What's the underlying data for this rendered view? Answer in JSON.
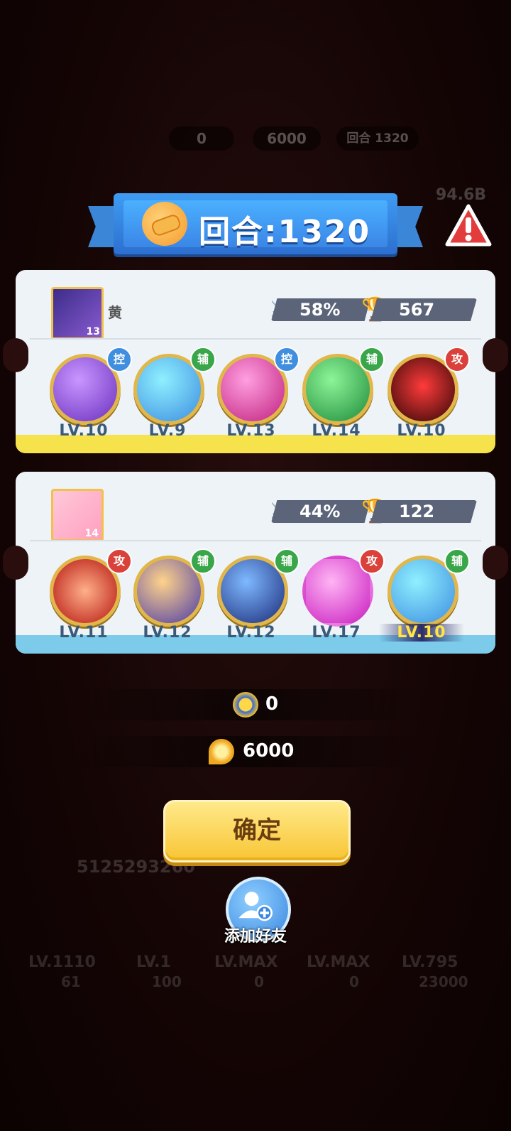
{
  "background": {
    "hud_top": {
      "stars": "0",
      "keys": "6000",
      "round": "回合 1320",
      "storage": "94.6B"
    },
    "player_id": "5125293260",
    "bottom_levels": [
      "LV.1110",
      "LV.1",
      "LV.MAX",
      "LV.MAX",
      "LV.795"
    ],
    "bottom_values": [
      "61",
      "100",
      "0",
      "0",
      "23000"
    ]
  },
  "ribbon": {
    "title": "回合:1320",
    "icon": "handshake-icon"
  },
  "warning": {
    "icon": "warning-icon"
  },
  "panels": [
    {
      "player_name": "黄",
      "avatar_badge": "13",
      "win_rate": "58%",
      "trophies": "567",
      "strip_color": "#f6e24a",
      "orbs": [
        {
          "tag": "控",
          "tag_color": "blue",
          "level": "LV.10",
          "name": "purple-butterfly-orb",
          "colors": [
            "#c996ff",
            "#6a2fbf"
          ]
        },
        {
          "tag": "辅",
          "tag_color": "green",
          "level": "LV.9",
          "name": "rainbow-swirl-orb",
          "colors": [
            "#8ff0ff",
            "#3d8de0"
          ]
        },
        {
          "tag": "控",
          "tag_color": "blue",
          "level": "LV.13",
          "name": "pink-blade-orb",
          "colors": [
            "#ff9fe0",
            "#c0207e"
          ]
        },
        {
          "tag": "辅",
          "tag_color": "green",
          "level": "LV.14",
          "name": "green-arrow-orb",
          "colors": [
            "#8df598",
            "#1e8a3a"
          ]
        },
        {
          "tag": "攻",
          "tag_color": "red",
          "level": "LV.10",
          "name": "venom-orb",
          "colors": [
            "#ff3b3b",
            "#300606"
          ]
        }
      ]
    },
    {
      "player_name": "",
      "avatar_badge": "14",
      "win_rate": "44%",
      "trophies": "122",
      "strip_color": "#7ccbea",
      "orbs": [
        {
          "tag": "攻",
          "tag_color": "red",
          "level": "LV.11",
          "name": "red-burst-orb",
          "colors": [
            "#ffb08a",
            "#b5140e"
          ]
        },
        {
          "tag": "辅",
          "tag_color": "green",
          "level": "LV.12",
          "name": "golden-figure-orb",
          "colors": [
            "#ffd38a",
            "#4a3aa8"
          ]
        },
        {
          "tag": "辅",
          "tag_color": "green",
          "level": "LV.12",
          "name": "hex-planet-orb",
          "colors": [
            "#7fb9ff",
            "#1a2a78"
          ]
        },
        {
          "tag": "攻",
          "tag_color": "red",
          "level": "LV.17",
          "name": "pink-shield-orb",
          "colors": [
            "#ffb4f4",
            "#c91ec0"
          ]
        },
        {
          "tag": "辅",
          "tag_color": "green",
          "level": "LV.10",
          "name": "rainbow-swirl-orb",
          "colors": [
            "#8ff0ff",
            "#3d8de0"
          ],
          "highlight": true
        }
      ]
    }
  ],
  "rewards": {
    "stars": "0",
    "keys": "6000"
  },
  "confirm_label": "确定",
  "add_friend_label": "添加好友"
}
